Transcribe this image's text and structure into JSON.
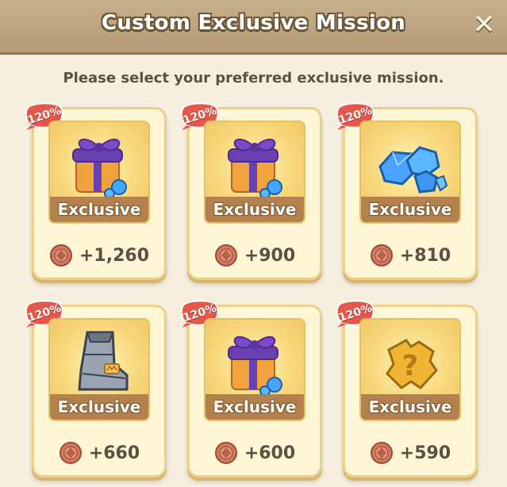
{
  "dialog": {
    "title": "Custom Exclusive Mission",
    "subtitle": "Please select your preferred exclusive mission."
  },
  "close_icon": "close-icon",
  "cards": [
    {
      "badge": "120%",
      "label": "Exclusive",
      "amount": "+1,260",
      "item_icon": "gift-box-icon",
      "currency_icon": "copper-coin-icon"
    },
    {
      "badge": "120%",
      "label": "Exclusive",
      "amount": "+900",
      "item_icon": "gift-box-icon",
      "currency_icon": "copper-coin-icon"
    },
    {
      "badge": "120%",
      "label": "Exclusive",
      "amount": "+810",
      "item_icon": "blue-gems-icon",
      "currency_icon": "copper-coin-icon"
    },
    {
      "badge": "120%",
      "label": "Exclusive",
      "amount": "+660",
      "item_icon": "armor-boot-icon",
      "currency_icon": "copper-coin-icon"
    },
    {
      "badge": "120%",
      "label": "Exclusive",
      "amount": "+600",
      "item_icon": "gift-box-icon",
      "currency_icon": "copper-coin-icon"
    },
    {
      "badge": "120%",
      "label": "Exclusive",
      "amount": "+590",
      "item_icon": "mystery-puzzle-icon",
      "currency_icon": "copper-coin-icon"
    }
  ],
  "colors": {
    "header": "#b39a74",
    "panel": "#f6efdf",
    "card": "#fff6d6",
    "badge": "#e4574a",
    "ribbon": "#b07d4c",
    "text": "#5b5043"
  }
}
